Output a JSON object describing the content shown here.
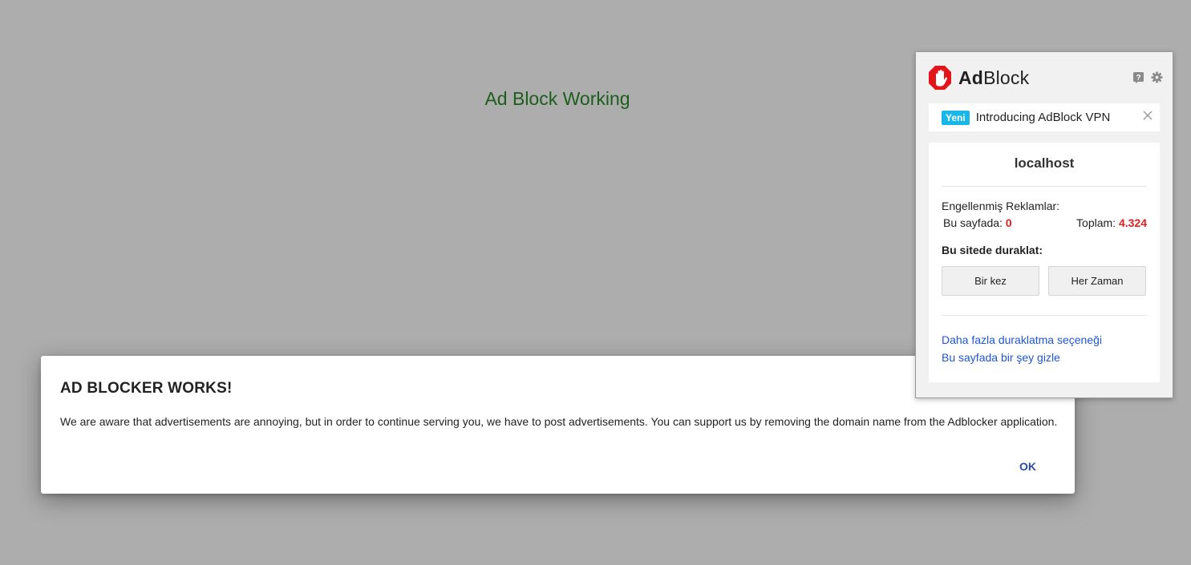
{
  "page": {
    "heading": "Ad Block Working"
  },
  "dialog": {
    "title": "AD BLOCKER WORKS!",
    "body": "We are aware that advertisements are annoying, but in order to continue serving you, we have to post advertisements. You can support us by removing the domain name from the Adblocker application.",
    "ok_label": "OK"
  },
  "extension": {
    "logo_bold": "Ad",
    "logo_rest": "Block",
    "icons": [
      "hand-stop-icon",
      "help-icon",
      "gear-icon",
      "close-icon"
    ],
    "brand_color": "#e3151a",
    "vpn_banner": {
      "badge": "Yeni",
      "text": "Introducing AdBlock VPN",
      "badge_color": "#19b6ea"
    },
    "domain": "localhost",
    "blocked_label": "Engellenmiş Reklamlar:",
    "page_count_label": "Bu sayfada:",
    "page_count": "0",
    "total_label": "Toplam:",
    "total_count": "4.324",
    "pause_label": "Bu sitede duraklat:",
    "pause_once": "Bir kez",
    "pause_always": "Her Zaman",
    "more_pause_link": "Daha fazla duraklatma seçeneği",
    "hide_link": "Bu sayfada bir şey gizle",
    "link_color": "#1f55d8"
  }
}
